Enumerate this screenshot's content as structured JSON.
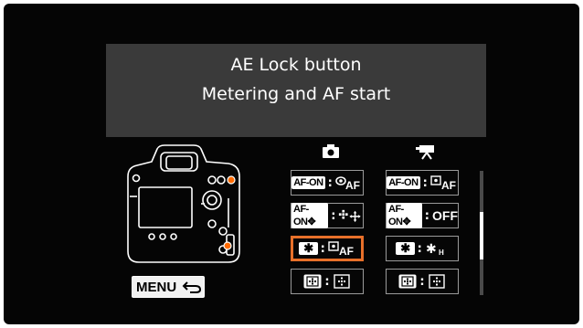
{
  "header": {
    "line1": "AE Lock button",
    "line2": "Metering and AF start"
  },
  "columns": {
    "still_icon": "camera-icon",
    "movie_icon": "movie-camera-icon"
  },
  "rows": [
    {
      "still": {
        "button": "AF-ON",
        "function": "metering-af-icon"
      },
      "movie": {
        "button": "AF-ON",
        "function": "metering-af-icon"
      }
    },
    {
      "still": {
        "button": "AF-ON-pt",
        "function": "af-point-direct-selection-icon"
      },
      "movie": {
        "button": "AF-ON-pt",
        "function": "OFF"
      }
    },
    {
      "still": {
        "button": "✱",
        "function": "metering-af-icon",
        "selected": true
      },
      "movie": {
        "button": "✱",
        "function": "ae-lock-hold-icon"
      }
    },
    {
      "still": {
        "button": "af-point-button",
        "function": "af-point-icon"
      },
      "movie": {
        "button": "af-point-button",
        "function": "af-point-icon"
      }
    }
  ],
  "footer": {
    "menu_label": "MENU",
    "back_icon": "return-arrow-icon"
  },
  "colors": {
    "selection": "#e8702a",
    "camera_highlight": "#ff6a00",
    "title_bg": "#3a3a3a",
    "screen_bg": "#050505"
  }
}
